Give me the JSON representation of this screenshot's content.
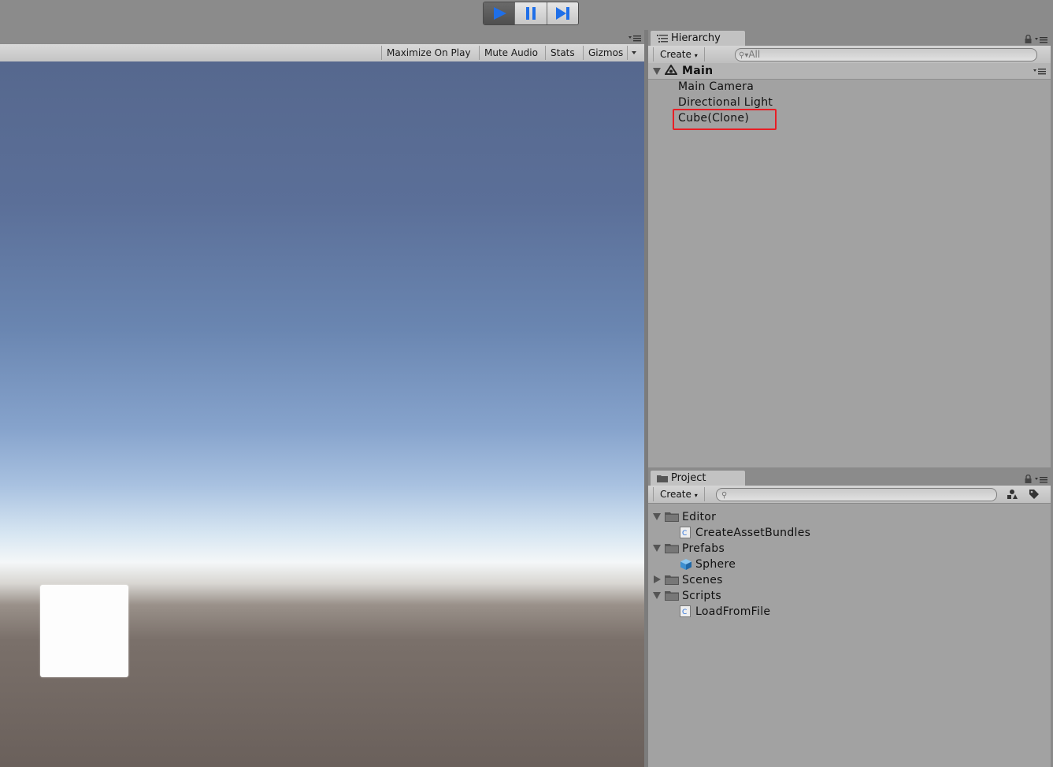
{
  "toolbar": {
    "play_icon": "play-icon",
    "pause_icon": "pause-icon",
    "step_icon": "step-icon",
    "accent": "#1f6fe8"
  },
  "game": {
    "buttons": [
      "Maximize On Play",
      "Mute Audio",
      "Stats",
      "Gizmos"
    ]
  },
  "hierarchy": {
    "tab_label": "Hierarchy",
    "create_label": "Create",
    "search_placeholder": "All",
    "scene_name": "Main",
    "items": [
      "Main Camera",
      "Directional Light",
      "Cube(Clone)"
    ],
    "highlight_color": "#e81e25"
  },
  "project": {
    "tab_label": "Project",
    "create_label": "Create",
    "tree": [
      {
        "label": "Editor",
        "type": "folder",
        "expanded": true
      },
      {
        "label": "CreateAssetBundles",
        "type": "script"
      },
      {
        "label": "Prefabs",
        "type": "folder",
        "expanded": true
      },
      {
        "label": "Sphere",
        "type": "prefab"
      },
      {
        "label": "Scenes",
        "type": "folder",
        "expanded": false
      },
      {
        "label": "Scripts",
        "type": "folder",
        "expanded": true
      },
      {
        "label": "LoadFromFile",
        "type": "script"
      }
    ]
  }
}
